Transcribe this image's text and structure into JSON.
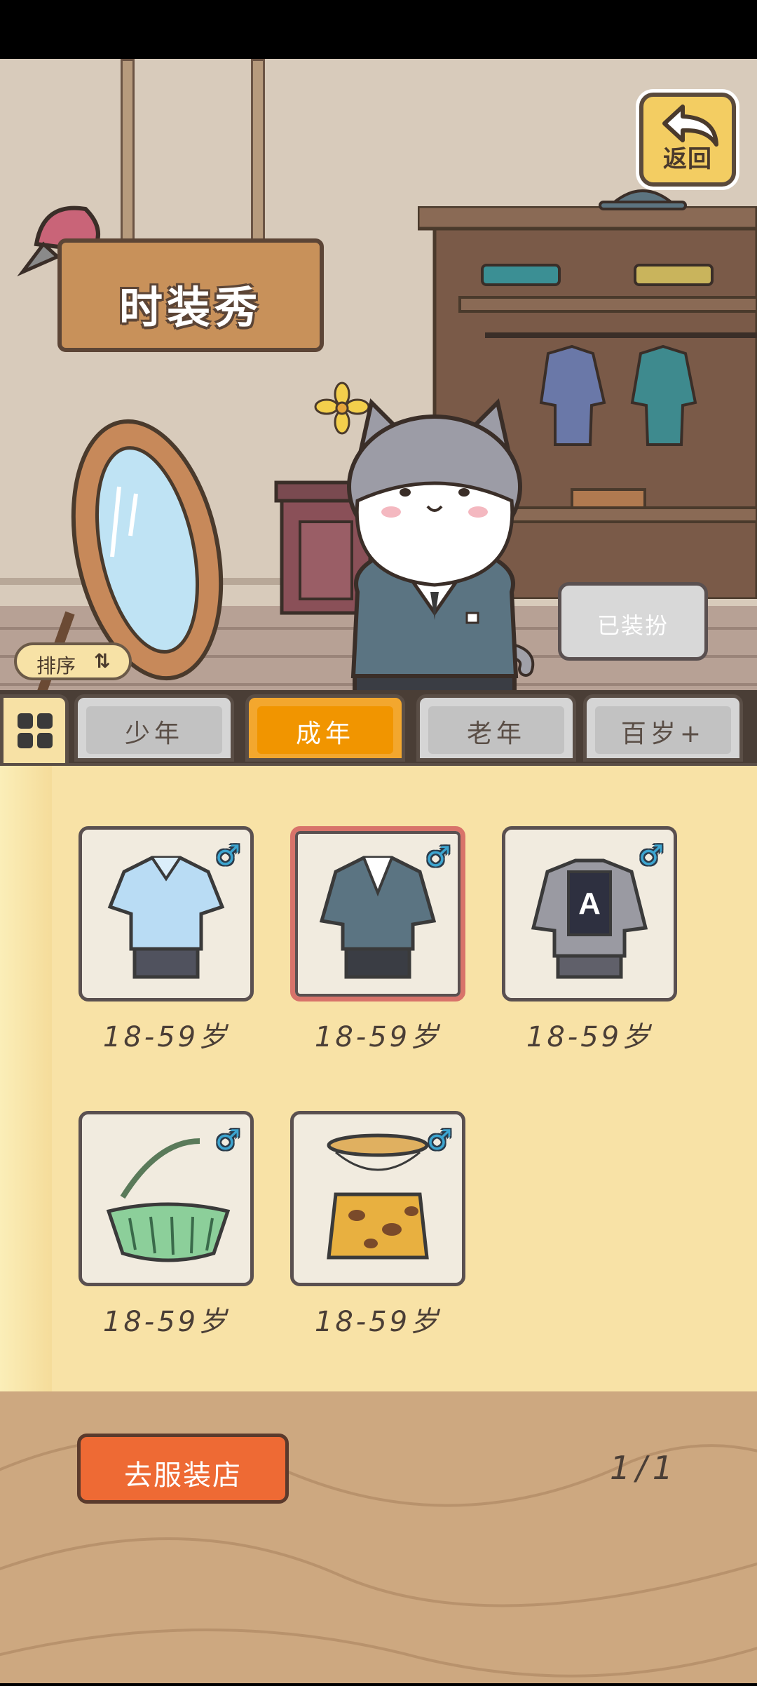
{
  "header": {
    "title": "时装秀",
    "back_label": "返回"
  },
  "scene": {
    "equipped_label": "已装扮",
    "sort_label": "排序",
    "sort_icon": "⇅"
  },
  "tabs": [
    {
      "label": "少年",
      "active": false
    },
    {
      "label": "成年",
      "active": true
    },
    {
      "label": "老年",
      "active": false
    },
    {
      "label": "百岁+",
      "active": false
    }
  ],
  "items": [
    {
      "name": "light-blue-shirt-outfit",
      "age": "18-59岁",
      "gender": "♂",
      "selected": false
    },
    {
      "name": "dark-school-uniform-outfit",
      "age": "18-59岁",
      "gender": "♂",
      "selected": true
    },
    {
      "name": "gray-jacket-a-outfit",
      "age": "18-59岁",
      "gender": "♂",
      "selected": false
    },
    {
      "name": "leaf-skirt-outfit",
      "age": "18-59岁",
      "gender": "♂",
      "selected": false
    },
    {
      "name": "leopard-hide-outfit",
      "age": "18-59岁",
      "gender": "♂",
      "selected": false
    }
  ],
  "footer": {
    "shop_label": "去服装店",
    "page_indicator": "1/1"
  }
}
